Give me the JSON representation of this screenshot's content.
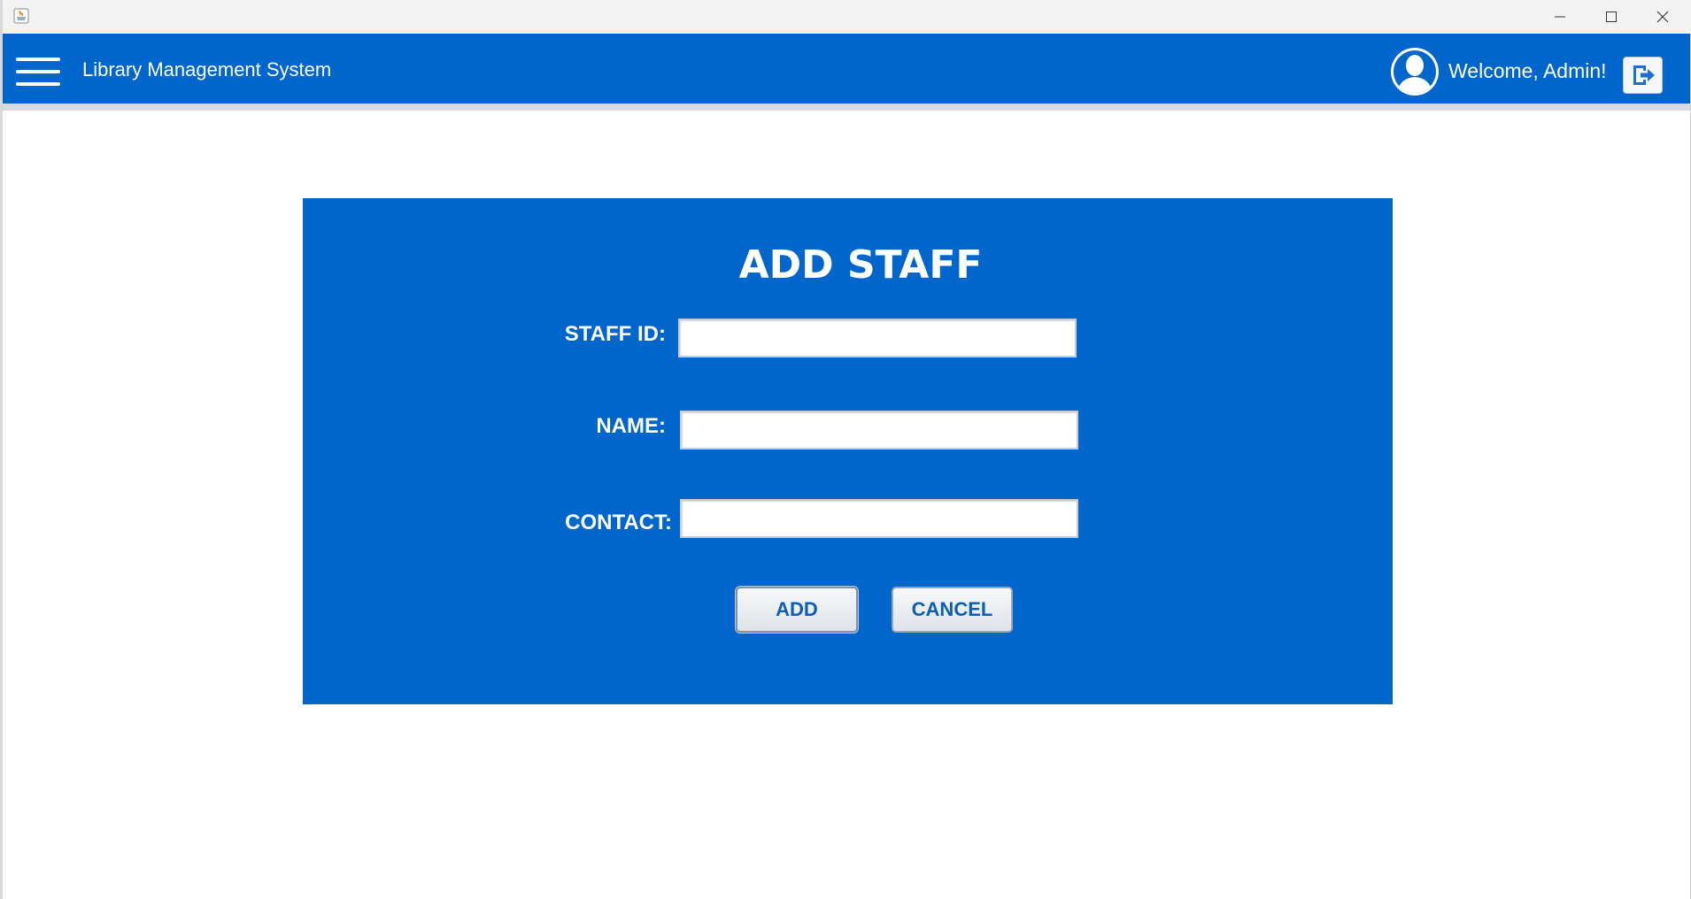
{
  "window": {
    "title": "",
    "controls": {
      "minimize_icon": "minimize-icon",
      "maximize_icon": "maximize-icon",
      "close_icon": "close-icon"
    }
  },
  "header": {
    "app_title": "Library Management System",
    "welcome_text": "Welcome, Admin!",
    "menu_icon": "hamburger-menu-icon",
    "avatar_icon": "user-avatar-icon",
    "logout_icon": "logout-icon",
    "background_color": "#0066cc"
  },
  "form": {
    "title": "ADD STAFF",
    "fields": [
      {
        "label": "STAFF ID:",
        "value": "",
        "placeholder": ""
      },
      {
        "label": "NAME:",
        "value": "",
        "placeholder": ""
      },
      {
        "label": "CONTACT:",
        "value": "",
        "placeholder": ""
      }
    ],
    "buttons": {
      "add_label": "ADD",
      "cancel_label": "CANCEL"
    },
    "panel_color": "#0066cc",
    "button_text_color": "#0b5fb8"
  }
}
